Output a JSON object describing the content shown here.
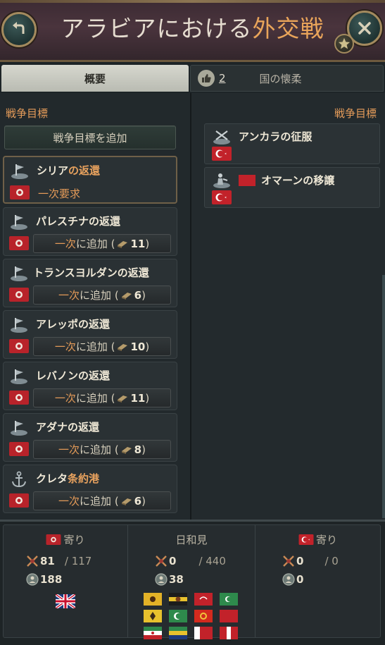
{
  "header": {
    "title_prefix": "アラビアにおける",
    "title_highlight": "外交戦"
  },
  "tabs": {
    "overview": "概要",
    "appeasement_count": "2",
    "appeasement": "国の懐柔"
  },
  "left": {
    "section_label": "戦争目標",
    "add_goal_prefix": "戦争目標",
    "add_goal_suffix": "を追加",
    "goals": [
      {
        "title_a": "シリア",
        "title_b": "の返還",
        "action": "一次要求"
      },
      {
        "title_a": "パレスチナ",
        "title_b": "の返還",
        "btn_o": "一次",
        "btn_rest": "に追加 (",
        "cost": "11",
        "close": ")"
      },
      {
        "title_a": "トランスヨルダン",
        "title_b": "の返還",
        "btn_o": "一次",
        "btn_rest": "に追加 (",
        "cost": "6",
        "close": ")"
      },
      {
        "title_a": "アレッポ",
        "title_b": "の返還",
        "btn_o": "一次",
        "btn_rest": "に追加 (",
        "cost": "10",
        "close": ")"
      },
      {
        "title_a": "レバノン",
        "title_b": "の返還",
        "btn_o": "一次",
        "btn_rest": "に追加 (",
        "cost": "11",
        "close": ")"
      },
      {
        "title_a": "アダナ",
        "title_b": "の返還",
        "btn_o": "一次",
        "btn_rest": "に追加 (",
        "cost": "8",
        "close": ")"
      },
      {
        "title_a": "クレタ",
        "title_b": "条約港",
        "btn_o": "一次",
        "btn_rest": "に追加 (",
        "cost": "6",
        "close": ")"
      }
    ]
  },
  "right": {
    "section_label": "戦争目標",
    "goals": [
      {
        "title_a": "アンカラ",
        "title_b": "の征服"
      },
      {
        "title_a": "オマーン",
        "title_b": "の移譲"
      }
    ]
  },
  "footer": {
    "left": {
      "label": "寄り",
      "mil": "81",
      "mil_total": "/ 117",
      "pop": "188"
    },
    "mid": {
      "label": "日和見",
      "mil": "0",
      "mil_total": "/ 440",
      "pop": "38"
    },
    "right": {
      "label": "寄り",
      "mil": "0",
      "mil_total": "/ 0",
      "pop": "0"
    }
  },
  "colors": {
    "accent_orange": "#e59c5a",
    "flag_red": "#b8232a",
    "panel_bg": "#22292c"
  }
}
